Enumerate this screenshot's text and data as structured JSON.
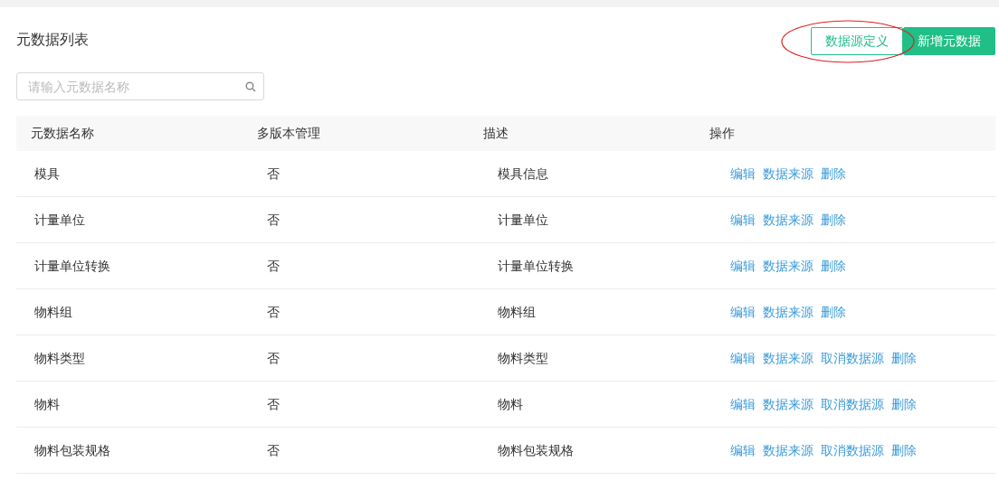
{
  "title": "元数据列表",
  "buttons": [
    {
      "label": "数据源定义",
      "kind": "outline"
    },
    {
      "label": "新增元数据",
      "kind": "primary"
    }
  ],
  "search": {
    "placeholder": "请输入元数据名称"
  },
  "table": {
    "columns": [
      "元数据名称",
      "多版本管理",
      "描述",
      "操作"
    ],
    "rows": [
      {
        "name": "模具",
        "multi_version": "否",
        "description": "模具信息",
        "actions": [
          "编辑",
          "数据来源",
          "删除"
        ]
      },
      {
        "name": "计量单位",
        "multi_version": "否",
        "description": "计量单位",
        "actions": [
          "编辑",
          "数据来源",
          "删除"
        ]
      },
      {
        "name": "计量单位转换",
        "multi_version": "否",
        "description": "计量单位转换",
        "actions": [
          "编辑",
          "数据来源",
          "删除"
        ]
      },
      {
        "name": "物料组",
        "multi_version": "否",
        "description": "物料组",
        "actions": [
          "编辑",
          "数据来源",
          "删除"
        ]
      },
      {
        "name": "物料类型",
        "multi_version": "否",
        "description": "物料类型",
        "actions": [
          "编辑",
          "数据来源",
          "取消数据源",
          "删除"
        ]
      },
      {
        "name": "物料",
        "multi_version": "否",
        "description": "物料",
        "actions": [
          "编辑",
          "数据来源",
          "取消数据源",
          "删除"
        ]
      },
      {
        "name": "物料包装规格",
        "multi_version": "否",
        "description": "物料包装规格",
        "actions": [
          "编辑",
          "数据来源",
          "取消数据源",
          "删除"
        ]
      }
    ]
  }
}
